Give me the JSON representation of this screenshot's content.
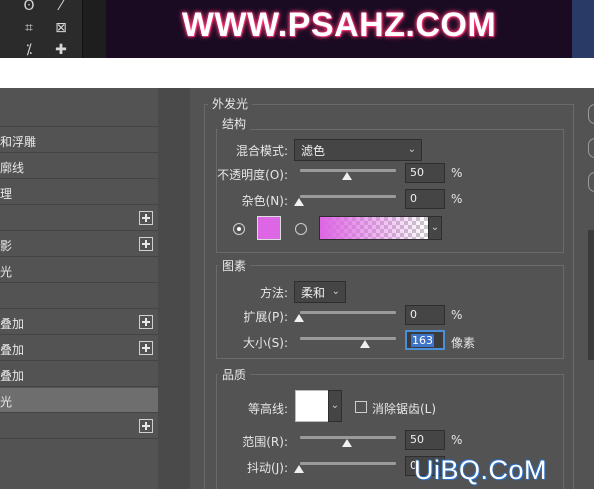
{
  "banner": {
    "text": "WWW.PSAHZ.COM"
  },
  "left_list": [
    {
      "label": "",
      "plus": false
    },
    {
      "label": "和浮雕",
      "plus": false
    },
    {
      "label": "廓线",
      "plus": false
    },
    {
      "label": "理",
      "plus": false
    },
    {
      "label": "",
      "plus": true
    },
    {
      "label": "影",
      "plus": true
    },
    {
      "label": "光",
      "plus": false
    },
    {
      "label": "",
      "plus": false
    },
    {
      "label": "叠加",
      "plus": true
    },
    {
      "label": "叠加",
      "plus": true
    },
    {
      "label": "叠加",
      "plus": false
    },
    {
      "label": "光",
      "plus": false,
      "selected": true
    },
    {
      "label": "",
      "plus": true
    }
  ],
  "outer_glow": {
    "title": "外发光",
    "structure": {
      "title": "结构",
      "blend_mode_label": "混合模式:",
      "blend_mode_value": "滤色",
      "opacity_label": "不透明度(O):",
      "opacity_value": "50",
      "opacity_unit": "%",
      "noise_label": "杂色(N):",
      "noise_value": "0",
      "noise_unit": "%",
      "color_hex": "#dd66e4"
    },
    "elements": {
      "title": "图素",
      "technique_label": "方法:",
      "technique_value": "柔和",
      "spread_label": "扩展(P):",
      "spread_value": "0",
      "spread_unit": "%",
      "size_label": "大小(S):",
      "size_value": "163",
      "size_unit": "像素"
    },
    "quality": {
      "title": "品质",
      "contour_label": "等高线:",
      "antialias_label": "消除锯齿(L)",
      "range_label": "范围(R):",
      "range_value": "50",
      "range_unit": "%",
      "jitter_label": "抖动(J):",
      "jitter_value": "0"
    }
  },
  "watermark": {
    "text": "UiBQ.CoM"
  }
}
